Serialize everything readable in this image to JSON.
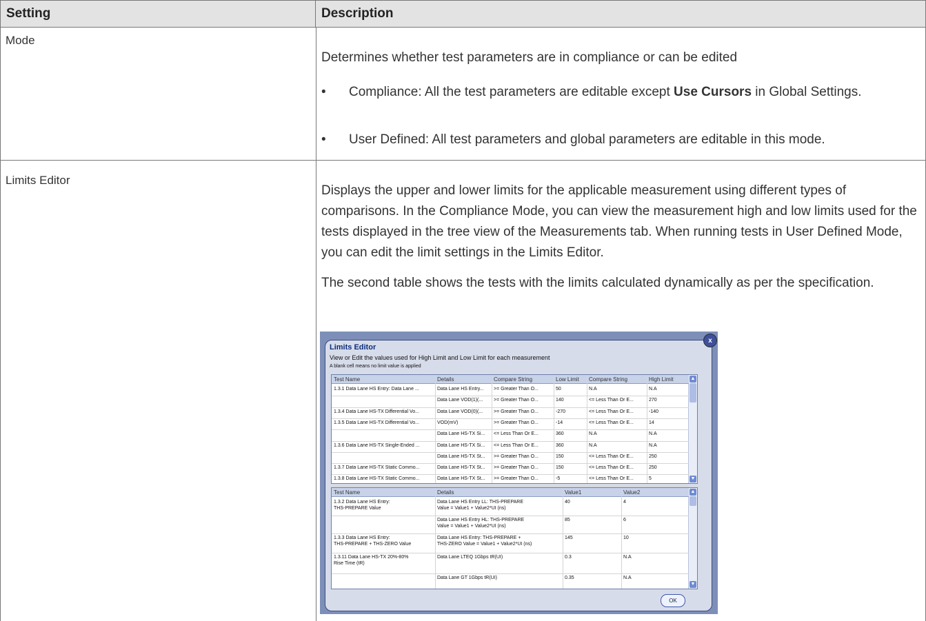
{
  "table": {
    "headers": {
      "setting": "Setting",
      "description": "Description"
    },
    "rows": [
      {
        "setting": "Mode",
        "intro": "Determines whether test parameters are in compliance or can be edited",
        "bullets": [
          {
            "pre": "Compliance: All the test parameters are editable except ",
            "bold": "Use Cursors",
            "post": " in Global Settings."
          },
          {
            "text": "User Defined: All test parameters and global parameters are editable in this mode."
          }
        ]
      },
      {
        "setting": "Limits Editor",
        "para1": "Displays the upper and lower limits for the applicable measurement using different types of comparisons. In the Compliance Mode, you can view the measurement high and low limits used for the tests displayed in the tree view of the Measurements tab. When running tests in User Defined Mode, you can edit the limit settings in the Limits Editor.",
        "para2": "The second table shows the tests with the limits calculated dynamically as per the specification."
      }
    ]
  },
  "dialog": {
    "title": "Limits Editor",
    "subtitle": "View or Edit the values used for High Limit and Low Limit for each measurement",
    "note": "A blank cell means no limit value is applied",
    "ok_label": "OK",
    "close_label": "x",
    "grid1": {
      "headers": [
        "Test Name",
        "Details",
        "Compare String",
        "Low Limit",
        "Compare String",
        "High Limit"
      ],
      "rows": [
        [
          "1.3.1 Data Lane HS Entry: Data Lane ...",
          "Data Lane HS Entry...",
          ">= Greater Than O...",
          "50",
          "N.A",
          "N.A"
        ],
        [
          "",
          "Data Lane VOD(1)(...",
          ">= Greater Than O...",
          "140",
          "<= Less Than Or E...",
          "270"
        ],
        [
          "1.3.4 Data Lane HS-TX Differential Vo...",
          "Data Lane VOD(0)(...",
          ">= Greater Than O...",
          "-270",
          "<= Less Than Or E...",
          "-140"
        ],
        [
          "1.3.5 Data Lane HS-TX Differential Vo...",
          "VOD(mV)",
          ">= Greater Than O...",
          "-14",
          "<= Less Than Or E...",
          "14"
        ],
        [
          "",
          "Data Lane HS-TX Si...",
          "<= Less Than Or E...",
          "360",
          "N.A",
          "N.A"
        ],
        [
          "1.3.6 Data Lane HS-TX Single-Ended ...",
          "Data Lane HS-TX Si...",
          "<= Less Than Or E...",
          "360",
          "N.A",
          "N.A"
        ],
        [
          "",
          "Data Lane HS-TX St...",
          ">= Greater Than O...",
          "150",
          "<= Less Than Or E...",
          "250"
        ],
        [
          "1.3.7 Data Lane HS-TX Static Commo...",
          "Data Lane HS-TX St...",
          ">= Greater Than O...",
          "150",
          "<= Less Than Or E...",
          "250"
        ],
        [
          "1.3.8 Data Lane HS-TX Static Commo...",
          "Data Lane HS-TX St...",
          ">= Greater Than O...",
          "-5",
          "<= Less Than Or E...",
          "5"
        ]
      ]
    },
    "grid2": {
      "headers": [
        "Test Name",
        "Details",
        "Value1",
        "Value2"
      ],
      "rows": [
        [
          "1.3.2 Data Lane HS Entry:\nTHS-PREPARE Value",
          "Data Lane HS Entry LL: THS-PREPARE\nValue = Value1 + Value2*UI (ns)",
          "40",
          "4"
        ],
        [
          "",
          "Data Lane HS Entry HL: THS-PREPARE\nValue = Value1 + Value2*UI (ns)",
          "85",
          "6"
        ],
        [
          "1.3.3 Data Lane HS Entry:\nTHS-PREPARE + THS-ZERO Value",
          "Data Lane HS Entry: THS-PREPARE +\nTHS-ZERO Value = Value1 + Value2*UI (ns)",
          "145",
          "10"
        ],
        [
          "1.3.11 Data Lane HS-TX 20%-80%\nRise Time (tR)",
          "Data Lane LTEQ 1Gbps tR(UI)",
          "0.3",
          "N.A"
        ],
        [
          "",
          "Data Lane GT 1Gbps tR(UI)",
          "0.35",
          "N.A"
        ]
      ]
    }
  }
}
